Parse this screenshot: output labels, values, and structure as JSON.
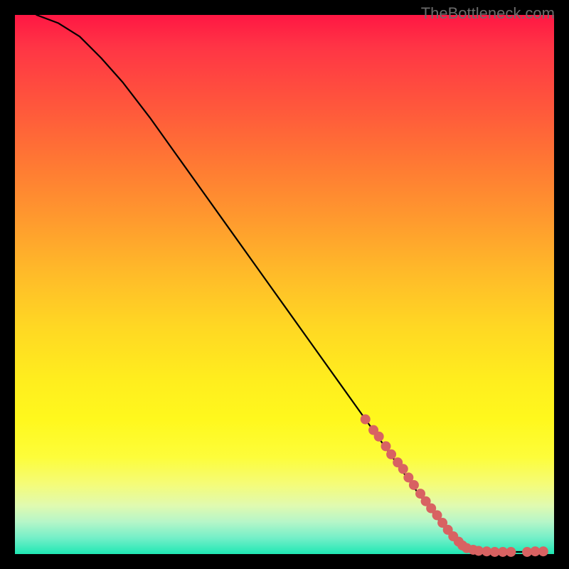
{
  "watermark": "TheBottleneck.com",
  "chart_data": {
    "type": "line",
    "title": "",
    "xlabel": "",
    "ylabel": "",
    "xlim": [
      0,
      100
    ],
    "ylim": [
      0,
      100
    ],
    "series": [
      {
        "name": "curve",
        "x": [
          4,
          8,
          12,
          16,
          20,
          25,
          30,
          35,
          40,
          45,
          50,
          55,
          60,
          65,
          70,
          75,
          80,
          83,
          86,
          90,
          94,
          98
        ],
        "values": [
          100,
          98.5,
          96,
          92,
          87.5,
          81,
          74,
          67,
          60,
          53,
          46,
          39,
          32,
          25,
          18,
          11,
          4.5,
          1.5,
          0.6,
          0.4,
          0.4,
          0.5
        ]
      },
      {
        "name": "highlight-dots",
        "x": [
          65,
          66.5,
          67.5,
          68.8,
          69.8,
          71,
          72,
          73,
          74,
          75.2,
          76.2,
          77.2,
          78.3,
          79.3,
          80.3,
          81.3,
          82.3,
          83,
          83.8,
          85,
          86,
          87.5,
          89,
          90.5,
          92,
          95,
          96.5,
          98
        ],
        "values": [
          25,
          23,
          21.8,
          20,
          18.5,
          17,
          15.8,
          14.2,
          12.8,
          11.2,
          9.8,
          8.5,
          7.2,
          5.8,
          4.5,
          3.3,
          2.3,
          1.6,
          1.1,
          0.8,
          0.6,
          0.5,
          0.4,
          0.4,
          0.4,
          0.4,
          0.5,
          0.5
        ]
      }
    ],
    "colors": {
      "curve": "#000000",
      "dots": "#d86262",
      "gradient_top": "#ff1744",
      "gradient_bottom": "#1fe8b4"
    }
  }
}
